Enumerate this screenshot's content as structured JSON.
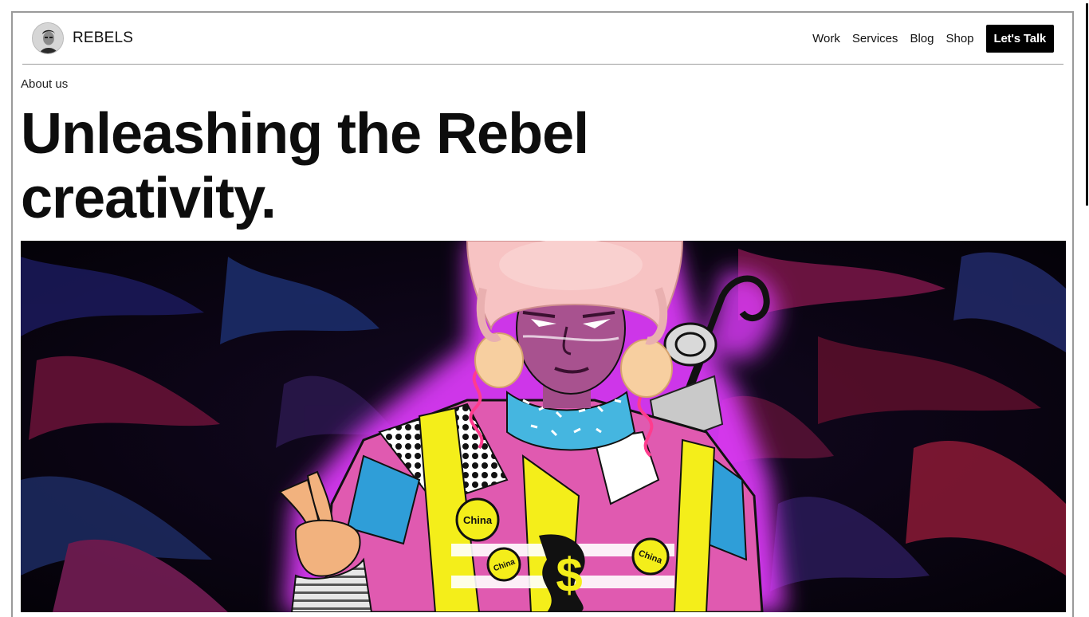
{
  "brand": {
    "name": "REBELS",
    "avatar_icon": "profile-avatar"
  },
  "nav": {
    "links": [
      "Work",
      "Services",
      "Blog",
      "Shop"
    ],
    "cta_label": "Let's Talk"
  },
  "page": {
    "eyebrow": "About us",
    "headline_line1": "Unleashing the Rebel",
    "headline_line2": "creativity."
  },
  "hero": {
    "badge_text": "China",
    "colors": {
      "glow": "#e23cff",
      "background": "#07030c",
      "accent_yellow": "#f4ee1a",
      "accent_pink": "#e8559f",
      "accent_blue": "#2f9ed8"
    }
  }
}
